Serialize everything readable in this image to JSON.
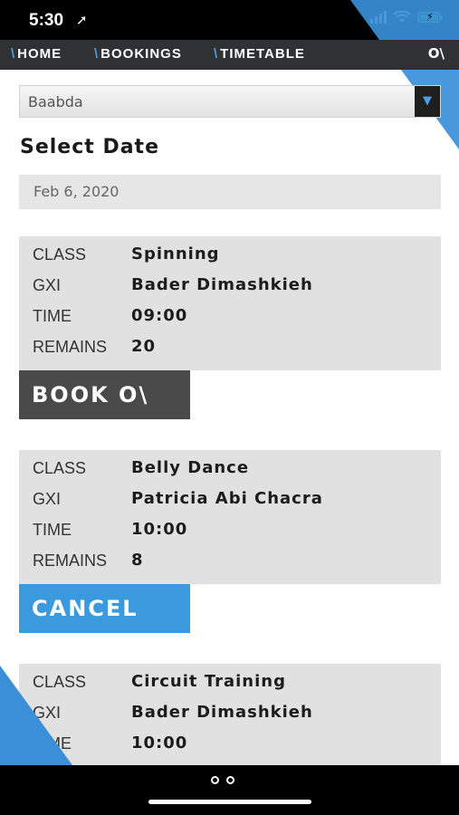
{
  "status": {
    "time": "5:30",
    "location_glyph": "➚"
  },
  "nav": {
    "items": [
      {
        "label": "HOME"
      },
      {
        "label": "BOOKINGS"
      },
      {
        "label": "TIMETABLE"
      }
    ],
    "logo": "O\\"
  },
  "location_select": {
    "value": "Baabda",
    "arrow": "▼"
  },
  "select_date": {
    "title": "Select Date",
    "value": "Feb 6, 2020"
  },
  "labels": {
    "class": "CLASS",
    "gxi": "GXI",
    "time": "TIME",
    "remains": "REMAINS"
  },
  "classes": [
    {
      "class": "Spinning",
      "gxi": "Bader Dimashkieh",
      "time": "09:00",
      "remains": "20",
      "action": "BOOK O\\"
    },
    {
      "class": "Belly Dance",
      "gxi": "Patricia Abi Chacra",
      "time": "10:00",
      "remains": "8",
      "action": "CANCEL"
    },
    {
      "class": "Circuit Training",
      "gxi": "Bader Dimashkieh",
      "time": "10:00"
    }
  ],
  "colors": {
    "accent": "#3b99de",
    "nav_bg": "#2f3133",
    "card_bg": "#e1e1e1",
    "book_bg": "#4a4a4a"
  },
  "icons": [
    "location-arrow-icon",
    "signal-icon",
    "wifi-icon",
    "battery-icon",
    "dropdown-arrow-icon",
    "page-dots-icon"
  ]
}
